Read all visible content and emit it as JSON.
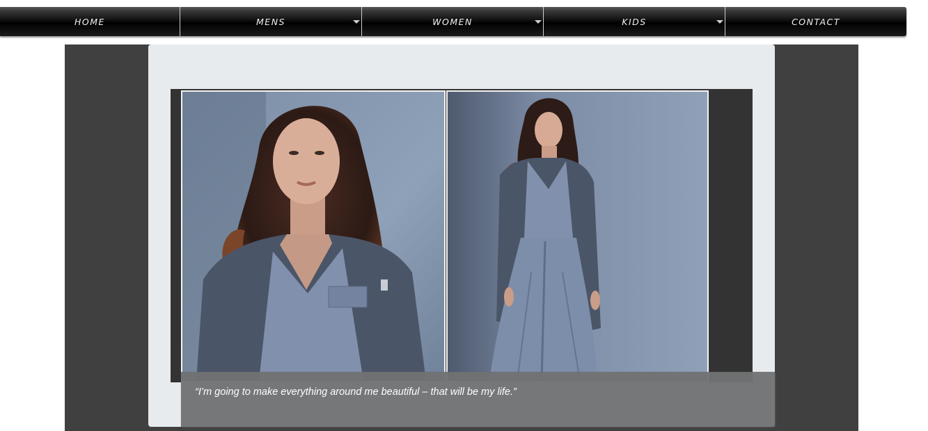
{
  "nav": {
    "items": [
      {
        "label": "HOME",
        "has_dropdown": false
      },
      {
        "label": "MENS",
        "has_dropdown": true
      },
      {
        "label": "WOMEN",
        "has_dropdown": true
      },
      {
        "label": "KIDS",
        "has_dropdown": true
      },
      {
        "label": "CONTACT",
        "has_dropdown": false
      }
    ]
  },
  "slider": {
    "caption": "“I’m going to make everything around me beautiful – that will be my life.”",
    "slides": [
      {
        "image": "portrait of woman in grey blazer (close-up)"
      },
      {
        "image": "woman in grey blazer and wide trousers (full length)"
      }
    ]
  },
  "colors": {
    "nav_bar": "#000000",
    "stage_background": "#404040",
    "panel_background": "#e7ebee",
    "caption_background": "#707172"
  }
}
